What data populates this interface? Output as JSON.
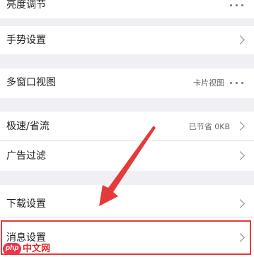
{
  "settings": {
    "brightness": {
      "label": "亮度调节"
    },
    "gesture": {
      "label": "手势设置"
    },
    "multi_window": {
      "label": "多窗口视图",
      "value": "卡片视图"
    },
    "speed_saving": {
      "label": "极速/省流",
      "value": "已节省 0KB"
    },
    "ad_filter": {
      "label": "广告过滤"
    },
    "download": {
      "label": "下载设置"
    },
    "messages": {
      "label": "消息设置"
    }
  },
  "icons": {
    "more": "more-dots-icon",
    "chevron": "chevron-right-icon"
  },
  "colors": {
    "highlight": "#e53a3a",
    "arrow": "#e53a3a",
    "background": "#efeff4",
    "row": "#ffffff"
  },
  "watermark": {
    "badge": "php",
    "text": "中文网"
  }
}
